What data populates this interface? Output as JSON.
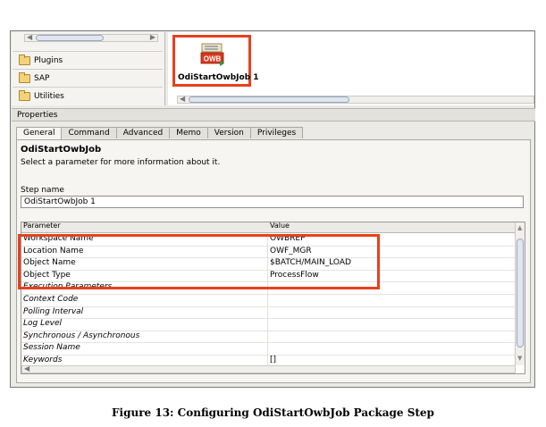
{
  "palette": {
    "items": [
      {
        "label": "Plugins"
      },
      {
        "label": "SAP"
      },
      {
        "label": "Utilities"
      }
    ]
  },
  "diagram": {
    "step_label": "OdiStartOwbJob 1",
    "icon_text": "OWB"
  },
  "properties": {
    "title": "Properties",
    "tabs": [
      "General",
      "Command",
      "Advanced",
      "Memo",
      "Version",
      "Privileges"
    ],
    "active_tab": "General",
    "step_title": "OdiStartOwbJob",
    "step_desc": "Select a parameter for more information about it.",
    "step_name_label": "Step name",
    "step_name_value": "OdiStartOwbJob 1",
    "grid": {
      "headers": [
        "Parameter",
        "Value"
      ],
      "rows": [
        {
          "param": "Workspace Name",
          "value": "OWBREP",
          "italic": false
        },
        {
          "param": "Location Name",
          "value": "OWF_MGR",
          "italic": false
        },
        {
          "param": "Object Name",
          "value": "$BATCH/MAIN_LOAD",
          "italic": false
        },
        {
          "param": "Object Type",
          "value": "ProcessFlow",
          "italic": false
        },
        {
          "param": "Execution Parameters",
          "value": "",
          "italic": true
        },
        {
          "param": "Context Code",
          "value": "",
          "italic": true
        },
        {
          "param": "Polling Interval",
          "value": "",
          "italic": true
        },
        {
          "param": "Log Level",
          "value": "",
          "italic": true
        },
        {
          "param": "Synchronous / Asynchronous",
          "value": "",
          "italic": true
        },
        {
          "param": "Session Name",
          "value": "",
          "italic": true
        },
        {
          "param": "Keywords",
          "value": "[]",
          "italic": true
        }
      ]
    }
  },
  "caption": "Figure 13: Configuring OdiStartOwbJob Package Step",
  "colors": {
    "highlight": "#e8401c"
  }
}
